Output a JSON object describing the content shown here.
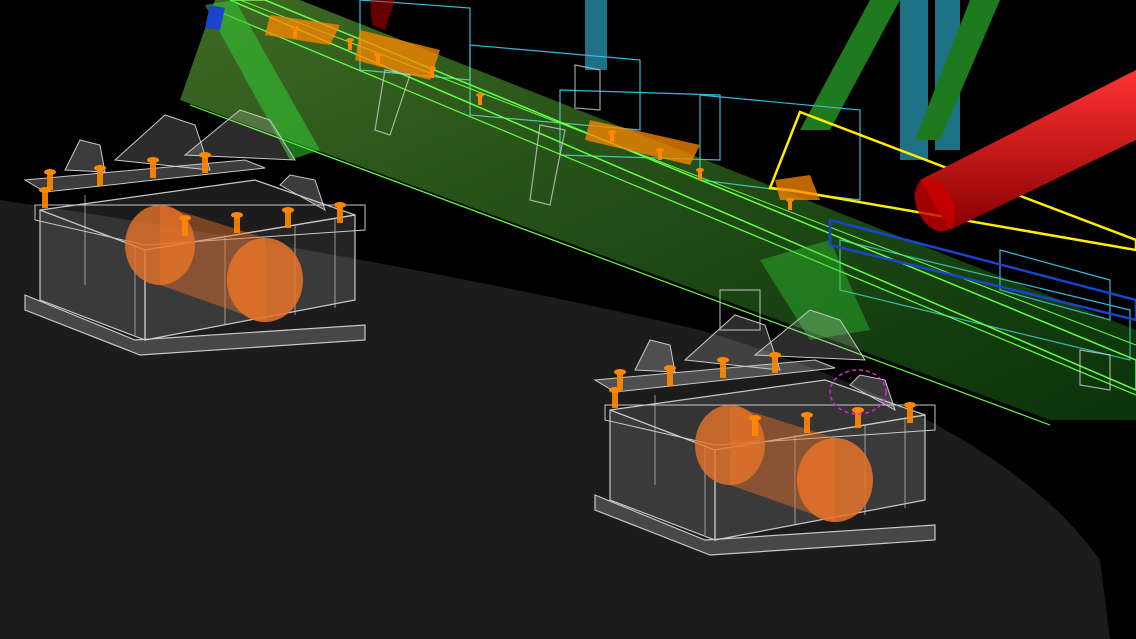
{
  "viewport": {
    "background": "#000000",
    "ground_color": "#1c1c1c"
  },
  "colors": {
    "steel_green": "#33cc33",
    "steel_green_light": "#66ff44",
    "steel_blue": "#2a9fd6",
    "steel_cyan": "#33bbdd",
    "pipe_red": "#cc0000",
    "highlight_yellow": "#ffee00",
    "bolt_orange": "#ff8800",
    "bearing_orange": "#e8742a",
    "support_gray": "#c8c8c8",
    "selection_magenta": "#dd22dd",
    "dark_blue_member": "#1a44cc"
  },
  "objects": [
    {
      "name": "support-left",
      "kind": "bearing-support"
    },
    {
      "name": "support-right",
      "kind": "bearing-support"
    },
    {
      "name": "beam-green",
      "kind": "inclined-beam"
    },
    {
      "name": "pipe-red",
      "kind": "pipe"
    },
    {
      "name": "frame-cyan",
      "kind": "frame"
    }
  ]
}
